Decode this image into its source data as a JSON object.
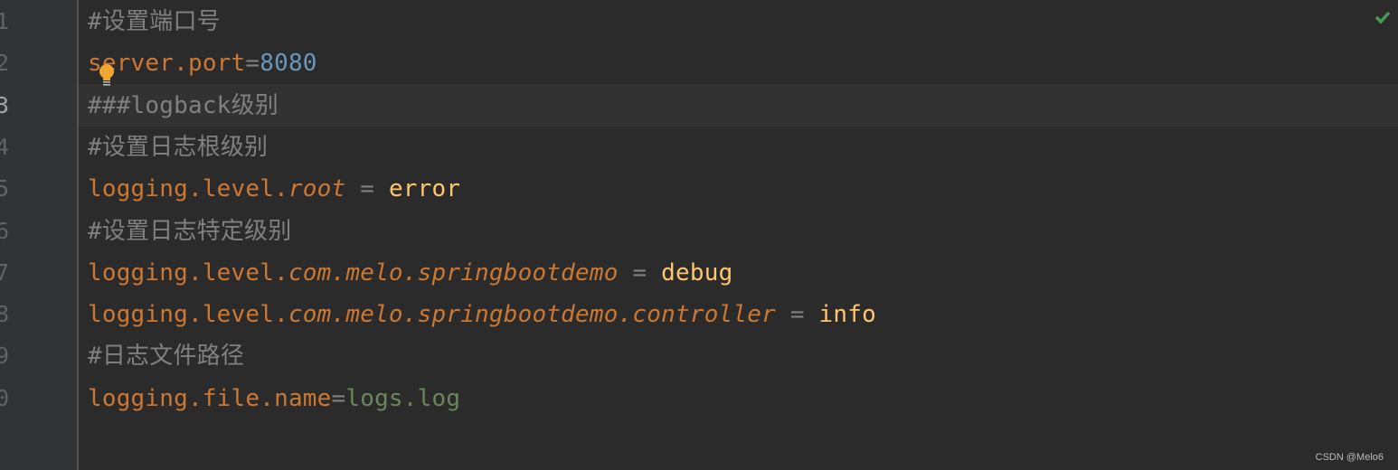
{
  "editor": {
    "current_line": 3,
    "line_numbers": [
      "1",
      "2",
      "3",
      "4",
      "5",
      "6",
      "7",
      "8",
      "9",
      "0"
    ],
    "lines": [
      [
        {
          "t": "#设置端口号",
          "c": "c"
        }
      ],
      [
        {
          "t": "server.port",
          "c": "k"
        },
        {
          "t": "=",
          "c": "e"
        },
        {
          "t": "8080",
          "c": "n"
        }
      ],
      [
        {
          "t": "###logback级别",
          "c": "c"
        }
      ],
      [
        {
          "t": "#设置日志根级别",
          "c": "c"
        }
      ],
      [
        {
          "t": "logging.level.",
          "c": "k"
        },
        {
          "t": "root",
          "c": "k i"
        },
        {
          "t": " = ",
          "c": "e"
        },
        {
          "t": "error",
          "c": "v"
        }
      ],
      [
        {
          "t": "#设置日志特定级别",
          "c": "c"
        }
      ],
      [
        {
          "t": "logging.level.",
          "c": "k"
        },
        {
          "t": "com.melo.springbootdemo",
          "c": "k i"
        },
        {
          "t": " = ",
          "c": "e"
        },
        {
          "t": "debug",
          "c": "v"
        }
      ],
      [
        {
          "t": "logging.level.",
          "c": "k"
        },
        {
          "t": "com.melo.springbootdemo.controller",
          "c": "k i"
        },
        {
          "t": " = ",
          "c": "e"
        },
        {
          "t": "info",
          "c": "v"
        }
      ],
      [
        {
          "t": "#日志文件路径",
          "c": "c"
        }
      ],
      [
        {
          "t": "logging.file.name",
          "c": "k"
        },
        {
          "t": "=",
          "c": "e"
        },
        {
          "t": "logs.log",
          "c": "s"
        }
      ]
    ],
    "status_icon": "check-icon",
    "hint_icon": "lightbulb-icon"
  },
  "colors": {
    "background": "#2b2b2b",
    "comment": "#808080",
    "key": "#cc7832",
    "number": "#6897bb",
    "value": "#ffc66d",
    "string": "#6a8759",
    "ok": "#499c54"
  },
  "watermark": "CSDN @Melo6"
}
